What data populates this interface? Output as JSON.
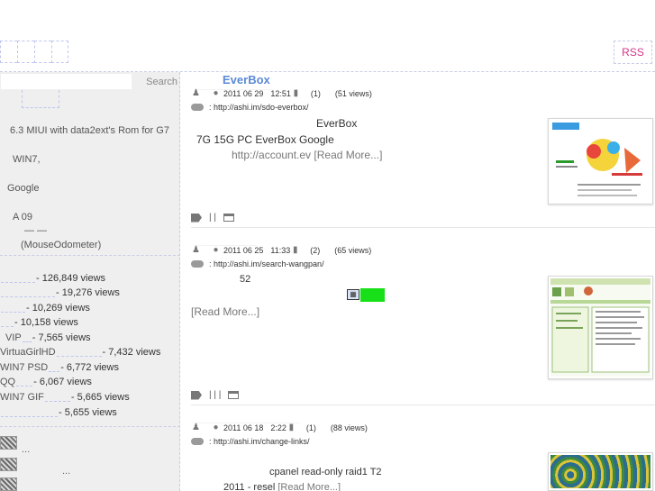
{
  "header": {
    "nav_tabs": [
      "",
      "",
      "",
      ""
    ],
    "rss_label": "RSS"
  },
  "sidebar": {
    "search": {
      "placeholder": "",
      "button_label": "Search"
    },
    "widget_texts": [
      "6.3 MIUI with data2ext's Rom for G7",
      "WIN7,",
      "Google",
      "A 09",
      "—       —",
      "(MouseOdometer)"
    ],
    "popular_posts": [
      {
        "label": "",
        "views": "- 126,849 views"
      },
      {
        "label": "",
        "views": "- 19,276 views"
      },
      {
        "label": "",
        "views": "- 10,269 views"
      },
      {
        "label": "",
        "views": "- 10,158 views"
      },
      {
        "label": "VIP",
        "views": "- 7,565 views"
      },
      {
        "label": "VirtuaGirlHD",
        "views": "- 7,432 views"
      },
      {
        "label": "WIN7  PSD",
        "views": "- 6,772 views"
      },
      {
        "label": "QQ",
        "views": "- 6,067 views"
      },
      {
        "label": "WIN7  GIF",
        "views": "- 5,665 views"
      },
      {
        "label": "",
        "views": "- 5,655 views"
      }
    ],
    "recent_comments": [
      {
        "text": "..."
      },
      {
        "text": "..."
      },
      {
        "text": ""
      }
    ]
  },
  "posts": [
    {
      "title": "EverBox",
      "date": "2011 06 29",
      "time": "12:51",
      "comments": "(1)",
      "views": "(51 views)",
      "link": ": http://ashi.im/sdo-everbox/",
      "line1": "EverBox",
      "line2": "7G        15G   PC                    EverBox  Google",
      "url_text": "http://account.ev",
      "read_more": "[Read More...]",
      "tags": "|   |"
    },
    {
      "title": "",
      "date": "2011 06 25",
      "time": "11:33",
      "comments": "(2)",
      "views": "(65 views)",
      "link": ": http://ashi.im/search-wangpan/",
      "line1": "52",
      "read_more": "[Read More...]",
      "tags": "|   |   |"
    },
    {
      "title": "",
      "date": "2011 06 18",
      "time": "2:22",
      "comments": "(1)",
      "views": "(88 views)",
      "link": ": http://ashi.im/change-links/",
      "line1": "cpanel              read-only        raid1                    T2",
      "line2": "2011          -                       resel",
      "read_more": "[Read More...]"
    }
  ]
}
